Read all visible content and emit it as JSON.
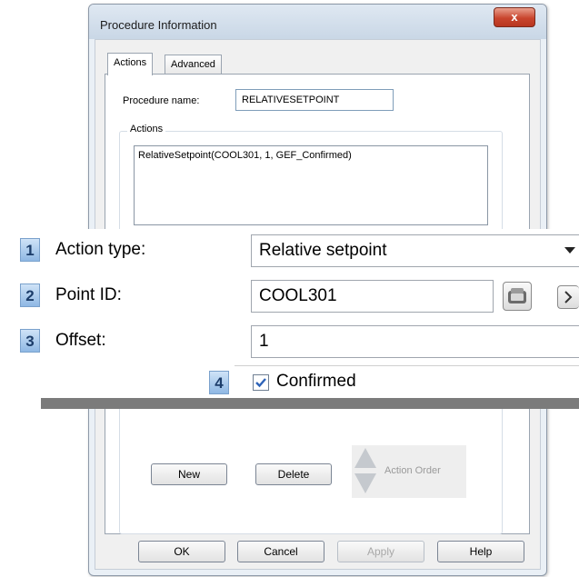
{
  "window": {
    "title": "Procedure Information",
    "close_glyph": "x"
  },
  "tabs": [
    "Actions",
    "Advanced"
  ],
  "procedure": {
    "label": "Procedure name:",
    "value": "RELATIVESETPOINT"
  },
  "actions_group": {
    "title": "Actions",
    "items": [
      "RelativeSetpoint(COOL301, 1, GEF_Confirmed)"
    ]
  },
  "callouts": {
    "action_type": {
      "num": "1",
      "label": "Action type:",
      "value": "Relative setpoint"
    },
    "point_id": {
      "num": "2",
      "label": "Point ID:",
      "value": "COOL301"
    },
    "offset": {
      "num": "3",
      "label": "Offset:",
      "value": "1"
    },
    "confirmed": {
      "num": "4",
      "label": "Confirmed",
      "checked": true
    }
  },
  "buttons": {
    "new": "New",
    "delete": "Delete",
    "action_order": "Action Order"
  },
  "dialog_buttons": {
    "ok": "OK",
    "cancel": "Cancel",
    "apply": "Apply",
    "help": "Help"
  },
  "icons": {
    "browse": "folder-browse-icon",
    "expand": "chevron-right-icon",
    "dropdown": "dropdown-arrow-icon"
  },
  "colors": {
    "close": "#c9452e",
    "badge": "#8fb8e4",
    "divider": "#7b7b7b",
    "check": "#2e63b8"
  }
}
